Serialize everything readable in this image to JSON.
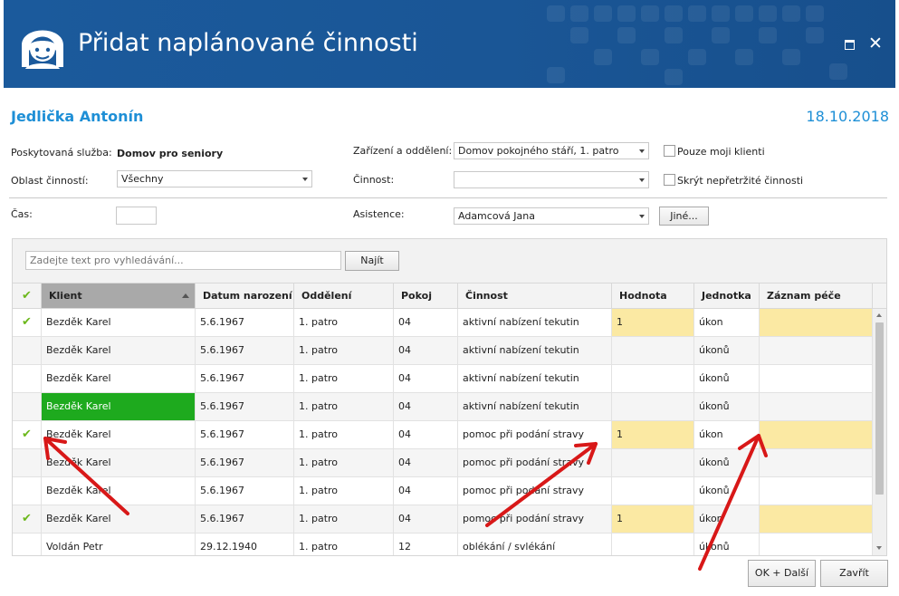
{
  "window": {
    "title": "Přidat naplánované činnosti"
  },
  "header": {
    "client_name": "Jedlička Antonín",
    "date": "18.10.2018"
  },
  "form": {
    "service_label": "Poskytovaná služba:",
    "service_value": "Domov pro seniory",
    "area_label": "Oblast činností:",
    "area_value": "Všechny",
    "facility_label": "Zařízení a oddělení:",
    "facility_value": "Domov pokojného stáří, 1. patro",
    "activity_label": "Činnost:",
    "activity_value": "",
    "only_my_clients_label": "Pouze moji klienti",
    "only_my_clients_checked": false,
    "hide_continuous_label": "Skrýt nepřetržité činnosti",
    "hide_continuous_checked": false,
    "time_label": "Čas:",
    "time_value": "",
    "assistance_label": "Asistence:",
    "assistance_value": "Adamcová Jana",
    "other_button": "Jiné..."
  },
  "search": {
    "placeholder": "Zadejte text pro vyhledávání...",
    "find_button": "Najít"
  },
  "grid": {
    "header_check": "✔",
    "columns": [
      "Klient",
      "Datum narození",
      "Oddělení",
      "Pokoj",
      "Činnost",
      "Hodnota",
      "Jednotka",
      "Záznam péče"
    ],
    "sorted_column": "Klient",
    "rows": [
      {
        "check": "✔",
        "client": "Bezděk Karel",
        "birth": "5.6.1967",
        "dept": "1. patro",
        "room": "04",
        "activity": "aktivní nabízení tekutin",
        "value": "1",
        "unit": "úkon",
        "record": ""
      },
      {
        "check": "",
        "client": "Bezděk Karel",
        "birth": "5.6.1967",
        "dept": "1. patro",
        "room": "04",
        "activity": "aktivní nabízení tekutin",
        "value": "",
        "unit": "úkonů",
        "record": ""
      },
      {
        "check": "",
        "client": "Bezděk Karel",
        "birth": "5.6.1967",
        "dept": "1. patro",
        "room": "04",
        "activity": "aktivní nabízení tekutin",
        "value": "",
        "unit": "úkonů",
        "record": ""
      },
      {
        "check": "",
        "client": "Bezděk Karel",
        "birth": "5.6.1967",
        "dept": "1. patro",
        "room": "04",
        "activity": "aktivní nabízení tekutin",
        "value": "",
        "unit": "úkonů",
        "record": ""
      },
      {
        "check": "✔",
        "client": "Bezděk Karel",
        "birth": "5.6.1967",
        "dept": "1. patro",
        "room": "04",
        "activity": "pomoc při podání stravy",
        "value": "1",
        "unit": "úkon",
        "record": ""
      },
      {
        "check": "",
        "client": "Bezděk Karel",
        "birth": "5.6.1967",
        "dept": "1. patro",
        "room": "04",
        "activity": "pomoc při podání stravy",
        "value": "",
        "unit": "úkonů",
        "record": ""
      },
      {
        "check": "",
        "client": "Bezděk Karel",
        "birth": "5.6.1967",
        "dept": "1. patro",
        "room": "04",
        "activity": "pomoc při podání stravy",
        "value": "",
        "unit": "úkonů",
        "record": ""
      },
      {
        "check": "✔",
        "client": "Bezděk Karel",
        "birth": "5.6.1967",
        "dept": "1. patro",
        "room": "04",
        "activity": "pomoc při podání stravy",
        "value": "1",
        "unit": "úkon",
        "record": ""
      },
      {
        "check": "",
        "client": "Voldán Petr",
        "birth": "29.12.1940",
        "dept": "1. patro",
        "room": "12",
        "activity": "oblékání / svlékání",
        "value": "",
        "unit": "úkonů",
        "record": ""
      }
    ]
  },
  "footer": {
    "ok_next_button": "OK + Další",
    "close_button": "Zavřít"
  },
  "colors": {
    "titlebar": "#1b5a9c",
    "accent_text": "#1e8fd6",
    "highlight_yellow": "#fbe9a3",
    "selected_green": "#1eaa1e",
    "check_green": "#6cb81c",
    "annotation_arrow": "#d81818"
  },
  "icons": {
    "app_logo": "girl-face-icon",
    "maximize": "maximize-icon",
    "close": "close-icon",
    "sort": "sort-ascending-icon",
    "check": "check-icon"
  }
}
